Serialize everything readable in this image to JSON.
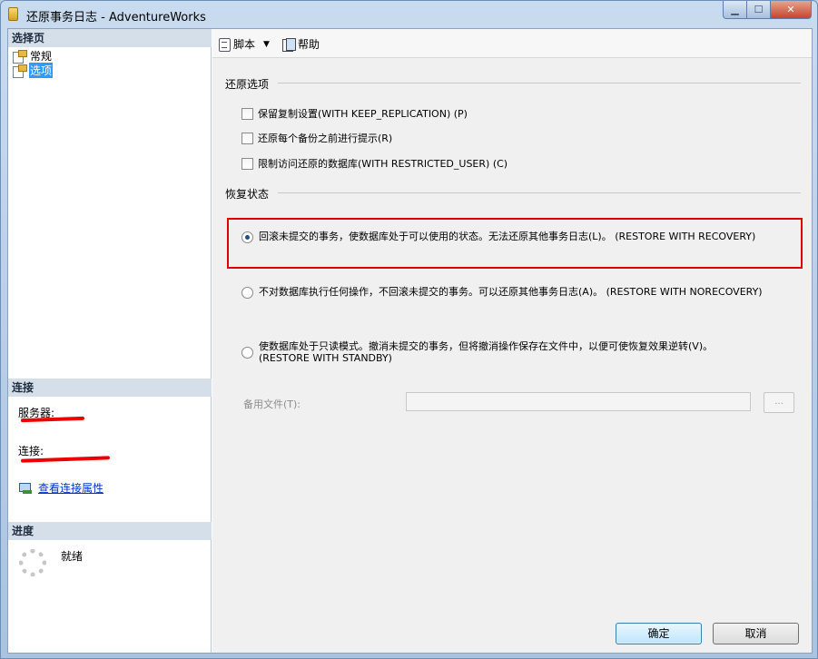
{
  "window": {
    "title": "还原事务日志 - AdventureWorks",
    "controls": {
      "minimize": "▁",
      "maximize": "☐",
      "close": "✕"
    }
  },
  "left_pane": {
    "select_page_header": "选择页",
    "pages": [
      {
        "label": "常规",
        "selected": false
      },
      {
        "label": "选项",
        "selected": true
      }
    ],
    "connection_header": "连接",
    "server_label": "服务器:",
    "connection_label": "连接:",
    "view_connection_properties": "查看连接属性",
    "progress_header": "进度",
    "progress_status": "就绪"
  },
  "toolbar": {
    "script_label": "脚本",
    "dropdown_glyph": "▼",
    "help_label": "帮助"
  },
  "restore_options": {
    "group_title": "还原选项",
    "options": [
      {
        "label": "保留复制设置(WITH KEEP_REPLICATION) (P)",
        "checked": false
      },
      {
        "label": "还原每个备份之前进行提示(R)",
        "checked": false
      },
      {
        "label": "限制访问还原的数据库(WITH RESTRICTED_USER) (C)",
        "checked": false
      }
    ]
  },
  "recovery_state": {
    "group_title": "恢复状态",
    "options": [
      {
        "label": "回滚未提交的事务，使数据库处于可以使用的状态。无法还原其他事务日志(L)。 (RESTORE WITH RECOVERY)",
        "line2": "",
        "checked": true
      },
      {
        "label": "不对数据库执行任何操作，不回滚未提交的事务。可以还原其他事务日志(A)。 (RESTORE WITH NORECOVERY)",
        "line2": "",
        "checked": false
      },
      {
        "label": "使数据库处于只读模式。撤消未提交的事务，但将撤消操作保存在文件中，以便可使恢复效果逆转(V)。",
        "line2": "(RESTORE WITH STANDBY)",
        "checked": false
      }
    ],
    "standby_file_label": "备用文件(T):",
    "standby_file_value": "",
    "browse_label": "..."
  },
  "buttons": {
    "ok": "确定",
    "cancel": "取消"
  },
  "colors": {
    "highlight_box": "#e00000",
    "selected_item": "#3399ff",
    "link": "#0033cc"
  }
}
